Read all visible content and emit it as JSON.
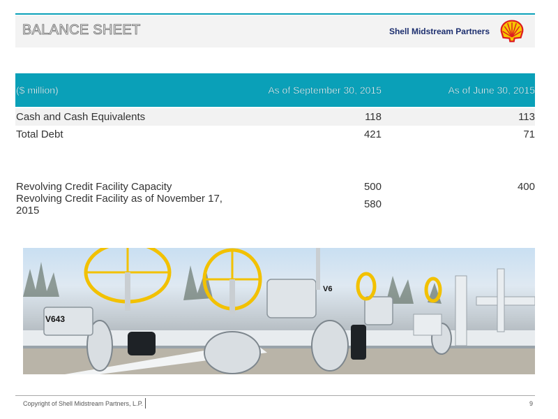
{
  "header": {
    "title": "BALANCE SHEET",
    "company": "Shell Midstream Partners"
  },
  "table": {
    "columns": [
      "($ million)",
      "As of September 30, 2015",
      "As of June 30, 2015"
    ],
    "rows": [
      {
        "label": "Cash and Cash Equivalents",
        "sep": "118",
        "jun": "113"
      },
      {
        "label": "Total Debt",
        "sep": "421",
        "jun": "71"
      },
      {
        "label": "Revolving Credit Facility Capacity",
        "sep": "500",
        "jun": "400"
      },
      {
        "label": "Revolving Credit Facility as of November 17, 2015",
        "sep": "580",
        "jun": ""
      }
    ]
  },
  "photo": {
    "valve_labels": [
      "V643",
      "V6"
    ]
  },
  "footer": {
    "copyright": "Copyright of Shell Midstream Partners, L.P.",
    "page_number": "9"
  },
  "colors": {
    "accent": "#0aa0b8",
    "shell_yellow": "#f7c600",
    "shell_red": "#dd1d21",
    "brand_navy": "#1d2f6f"
  }
}
